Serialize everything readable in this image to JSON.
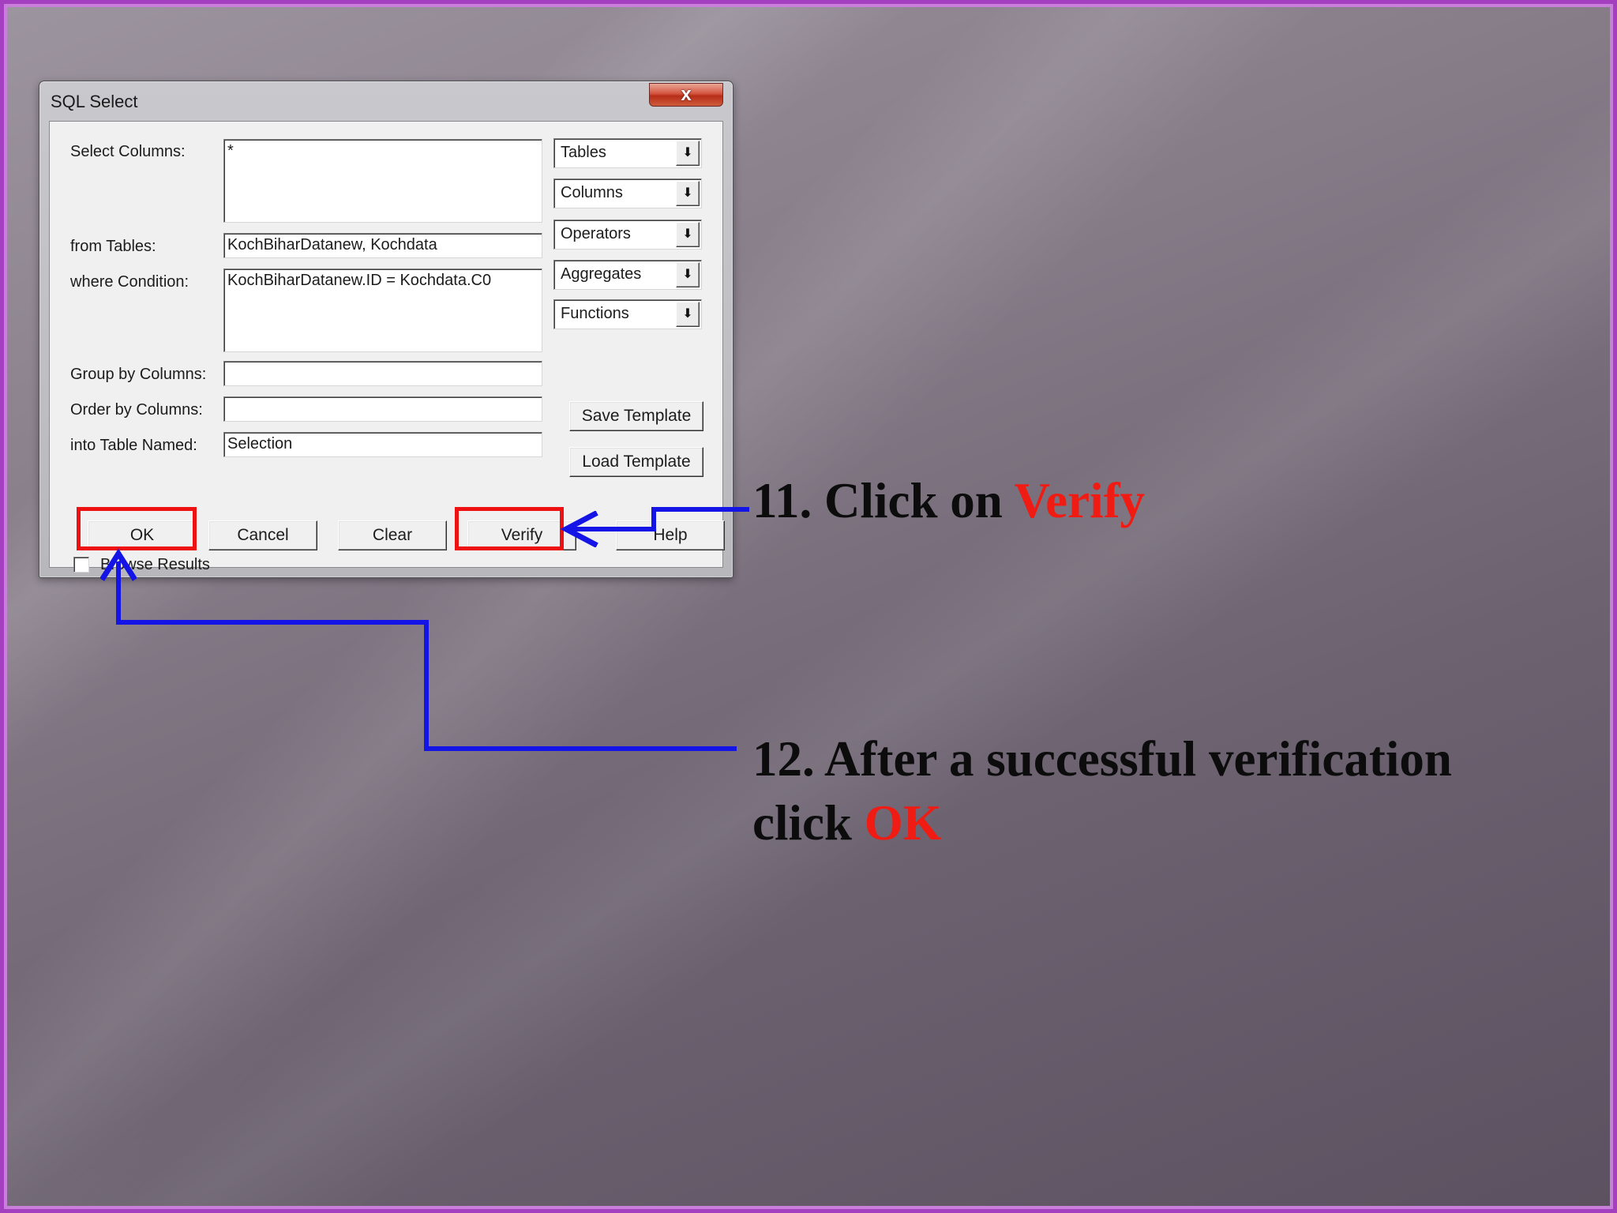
{
  "dialog": {
    "title": "SQL Select",
    "close_glyph": "x",
    "labels": {
      "select_columns": "Select Columns:",
      "from_tables": "from Tables:",
      "where_condition": "where Condition:",
      "group_by": "Group by Columns:",
      "order_by": "Order by Columns:",
      "into_table": "into Table Named:",
      "browse_results": "Browse Results"
    },
    "values": {
      "select_columns": "*",
      "from_tables": "KochBiharDatanew, Kochdata",
      "where_condition": "KochBiharDatanew.ID = Kochdata.C0",
      "group_by": "",
      "order_by": "",
      "into_table": "Selection"
    },
    "browse_results_checked": false,
    "dropdowns": [
      "Tables",
      "Columns",
      "Operators",
      "Aggregates",
      "Functions"
    ],
    "dropdown_arrow": "⬇",
    "buttons": {
      "save_template": "Save Template",
      "load_template": "Load Template",
      "ok": "OK",
      "cancel": "Cancel",
      "clear": "Clear",
      "verify": "Verify",
      "help": "Help"
    }
  },
  "annotations": {
    "step11_prefix": "11. Click on ",
    "step11_highlight": "Verify",
    "step12_line1": "12. After a successful verification",
    "step12_line2_prefix": "click ",
    "step12_line2_highlight": "OK"
  },
  "colors": {
    "highlight": "#ee1111",
    "connector": "#1414e6",
    "slide_border": "#a43fbf"
  }
}
